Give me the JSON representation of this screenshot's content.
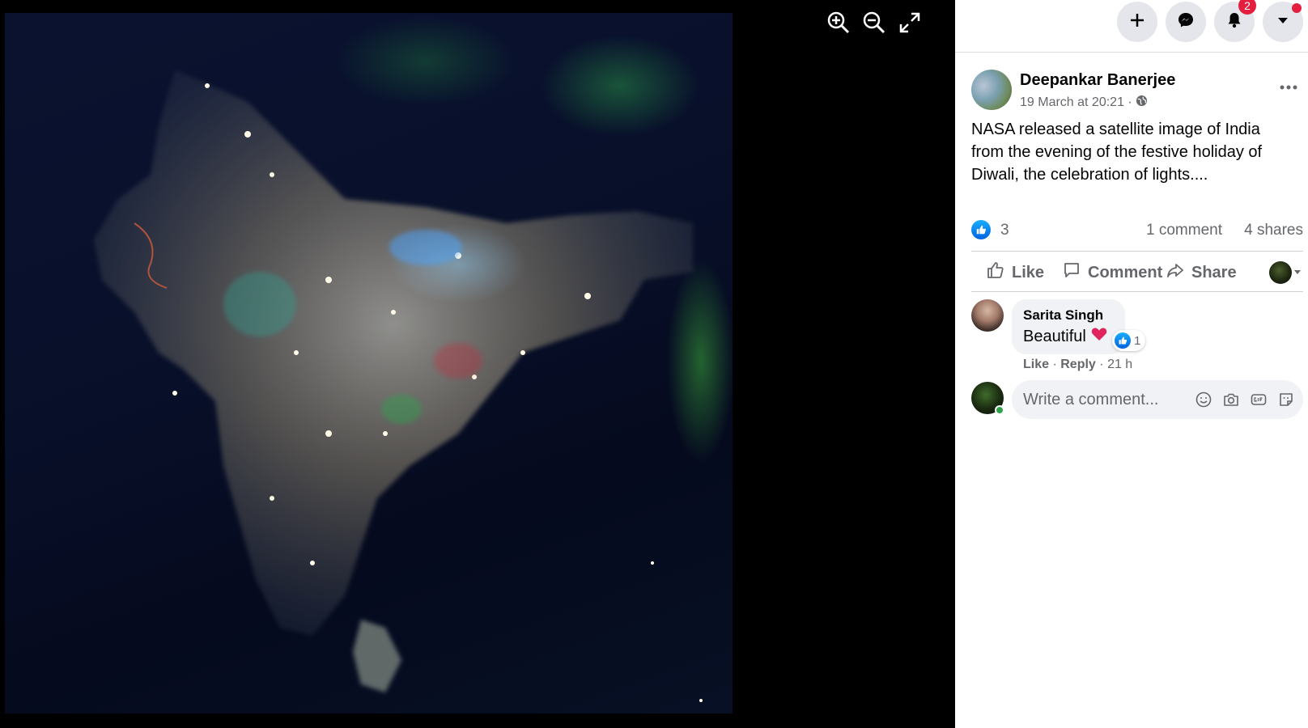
{
  "photo": {
    "alt_label": ""
  },
  "viewer_tools": {
    "zoom_in": "zoom-in-icon",
    "zoom_out": "zoom-out-icon",
    "fullscreen": "fullscreen-icon"
  },
  "topbar": {
    "notifications_badge": "2"
  },
  "post": {
    "author": "Deepankar Banerjee",
    "timestamp": "19 March at 20:21 ·",
    "text": "NASA released a satellite image of India from the evening of the festive holiday of Diwali, the celebration of lights....",
    "reaction_count": "3",
    "comment_count": "1 comment",
    "share_count": "4 shares"
  },
  "actions": {
    "like": "Like",
    "comment": "Comment",
    "share": "Share"
  },
  "comment": {
    "name": "Sarita Singh",
    "text": "Beautiful",
    "reaction_count": "1",
    "like": "Like",
    "reply": "Reply",
    "time": "21 h"
  },
  "composer": {
    "placeholder": "Write a comment..."
  },
  "colors": {
    "accent": "#1877f2",
    "badge": "#e41e3f",
    "muted": "#65676b"
  }
}
